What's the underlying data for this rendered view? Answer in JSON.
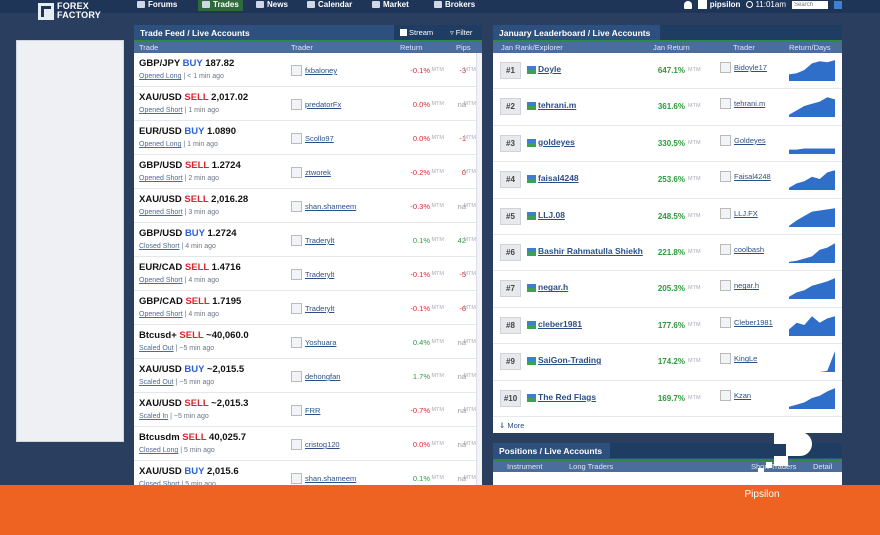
{
  "nav": {
    "logo_line1": "FOREX",
    "logo_line2": "FACTORY",
    "items": [
      {
        "label": "Forums",
        "icon": "forums-icon"
      },
      {
        "label": "Trades",
        "icon": "trades-icon",
        "active": true
      },
      {
        "label": "News",
        "icon": "news-icon"
      },
      {
        "label": "Calendar",
        "icon": "calendar-icon"
      },
      {
        "label": "Market",
        "icon": "market-icon"
      },
      {
        "label": "Brokers",
        "icon": "brokers-icon"
      }
    ],
    "username": "pipsilon",
    "time": "11:01am",
    "search_placeholder": "Search"
  },
  "feed": {
    "title": "Trade Feed / Live Accounts",
    "stream_label": "Stream",
    "filter_label": "Filter",
    "col_trade": "Trade",
    "col_trader": "Trader",
    "col_return": "Return",
    "col_pips": "Pips",
    "rows": [
      {
        "pair": "GBP/JPY",
        "side": "BUY",
        "price": "187.82",
        "action": "Opened Long",
        "time": "< 1 min ago",
        "trader": "fxbaloney",
        "ret": "-0.1%",
        "pips": "-3"
      },
      {
        "pair": "XAU/USD",
        "side": "SELL",
        "price": "2,017.02",
        "action": "Opened Short",
        "time": "1 min ago",
        "trader": "predatorFx",
        "ret": "0.0%",
        "pips": "na"
      },
      {
        "pair": "EUR/USD",
        "side": "BUY",
        "price": "1.0890",
        "action": "Opened Long",
        "time": "1 min ago",
        "trader": "Scollo97",
        "ret": "0.0%",
        "pips": "-1"
      },
      {
        "pair": "GBP/USD",
        "side": "SELL",
        "price": "1.2724",
        "action": "Opened Short",
        "time": "2 min ago",
        "trader": "ztworek",
        "ret": "-0.2%",
        "pips": "0"
      },
      {
        "pair": "XAU/USD",
        "side": "SELL",
        "price": "2,016.28",
        "action": "Opened Short",
        "time": "3 min ago",
        "trader": "shan.shameem",
        "ret": "-0.3%",
        "pips": "na"
      },
      {
        "pair": "GBP/USD",
        "side": "BUY",
        "price": "1.2724",
        "action": "Closed Short",
        "time": "4 min ago",
        "trader": "Traderylt",
        "ret": "0.1%",
        "pips": "42"
      },
      {
        "pair": "EUR/CAD",
        "side": "SELL",
        "price": "1.4716",
        "action": "Opened Short",
        "time": "4 min ago",
        "trader": "Traderylt",
        "ret": "-0.1%",
        "pips": "-5"
      },
      {
        "pair": "GBP/CAD",
        "side": "SELL",
        "price": "1.7195",
        "action": "Opened Short",
        "time": "4 min ago",
        "trader": "Traderylt",
        "ret": "-0.1%",
        "pips": "-6"
      },
      {
        "pair": "Btcusd+",
        "side": "SELL",
        "price": "~40,060.0",
        "action": "Scaled Out",
        "time": "~5 min ago",
        "trader": "Yoshuara",
        "ret": "0.4%",
        "pips": "na"
      },
      {
        "pair": "XAU/USD",
        "side": "BUY",
        "price": "~2,015.5",
        "action": "Scaled Out",
        "time": "~5 min ago",
        "trader": "dehongfan",
        "ret": "1.7%",
        "pips": "na"
      },
      {
        "pair": "XAU/USD",
        "side": "SELL",
        "price": "~2,015.3",
        "action": "Scaled In",
        "time": "~5 min ago",
        "trader": "FRR",
        "ret": "-0.7%",
        "pips": "na"
      },
      {
        "pair": "Btcusdm",
        "side": "SELL",
        "price": "40,025.7",
        "action": "Closed Long",
        "time": "5 min ago",
        "trader": "cristog120",
        "ret": "0.0%",
        "pips": "na"
      },
      {
        "pair": "XAU/USD",
        "side": "BUY",
        "price": "2,015.6",
        "action": "Closed Short",
        "time": "5 min ago",
        "trader": "shan.shameem",
        "ret": "0.1%",
        "pips": "na"
      }
    ],
    "mtm": "MTM"
  },
  "leaderboard": {
    "title": "January Leaderboard / Live Accounts",
    "col_rank": "Jan Rank/Explorer",
    "col_return": "Jan Return",
    "col_trader": "Trader",
    "col_rd": "Return/Days",
    "more": "More",
    "rows": [
      {
        "rank": "#1",
        "name": "Doyle",
        "ret": "647.1%",
        "trader": "Bidoyle17",
        "spark": [
          0.3,
          0.35,
          0.5,
          0.8,
          0.9,
          0.85,
          0.95
        ]
      },
      {
        "rank": "#2",
        "name": "tehrani.m",
        "ret": "361.6%",
        "trader": "tehrani.m",
        "spark": [
          0.1,
          0.3,
          0.5,
          0.6,
          0.7,
          0.9,
          0.8
        ]
      },
      {
        "rank": "#3",
        "name": "goldeyes",
        "ret": "330.5%",
        "trader": "Goldeyes",
        "spark": [
          0.2,
          0.2,
          0.25,
          0.25,
          0.25,
          0.25,
          0.25
        ]
      },
      {
        "rank": "#4",
        "name": "faisal4248",
        "ret": "253.6%",
        "trader": "Faisal4248",
        "spark": [
          0.1,
          0.3,
          0.4,
          0.6,
          0.5,
          0.8,
          0.9
        ]
      },
      {
        "rank": "#5",
        "name": "LLJ.08",
        "ret": "248.5%",
        "trader": "LLJ.FX",
        "spark": [
          0.05,
          0.3,
          0.5,
          0.7,
          0.75,
          0.8,
          0.85
        ]
      },
      {
        "rank": "#6",
        "name": "Bashir Rahmatulla Shiekh",
        "ret": "221.8%",
        "trader": "coolbash",
        "spark": [
          0.05,
          0.1,
          0.2,
          0.3,
          0.6,
          0.7,
          0.9
        ]
      },
      {
        "rank": "#7",
        "name": "negar.h",
        "ret": "205.3%",
        "trader": "negar.h",
        "spark": [
          0.1,
          0.3,
          0.4,
          0.6,
          0.7,
          0.8,
          0.95
        ]
      },
      {
        "rank": "#8",
        "name": "cleber1981",
        "ret": "177.6%",
        "trader": "Cleber1981",
        "spark": [
          0.3,
          0.6,
          0.5,
          0.9,
          0.6,
          0.8,
          0.9
        ]
      },
      {
        "rank": "#9",
        "name": "SaiGon-Trading",
        "ret": "174.2%",
        "trader": "KingLe",
        "spark": [
          0.0,
          0.0,
          0.0,
          0.0,
          0.0,
          0.05,
          0.95
        ]
      },
      {
        "rank": "#10",
        "name": "The Red Flags",
        "ret": "169.7%",
        "trader": "Kzan",
        "spark": [
          0.1,
          0.2,
          0.3,
          0.5,
          0.6,
          0.8,
          0.95
        ]
      }
    ]
  },
  "positions": {
    "title": "Positions / Live Accounts",
    "col_instrument": "Instrument",
    "col_long": "Long Traders",
    "col_short": "Short Traders",
    "col_detail": "Detail"
  },
  "footer": {
    "watermark": "Pipsilon",
    "bar_color": "#ee6222"
  }
}
